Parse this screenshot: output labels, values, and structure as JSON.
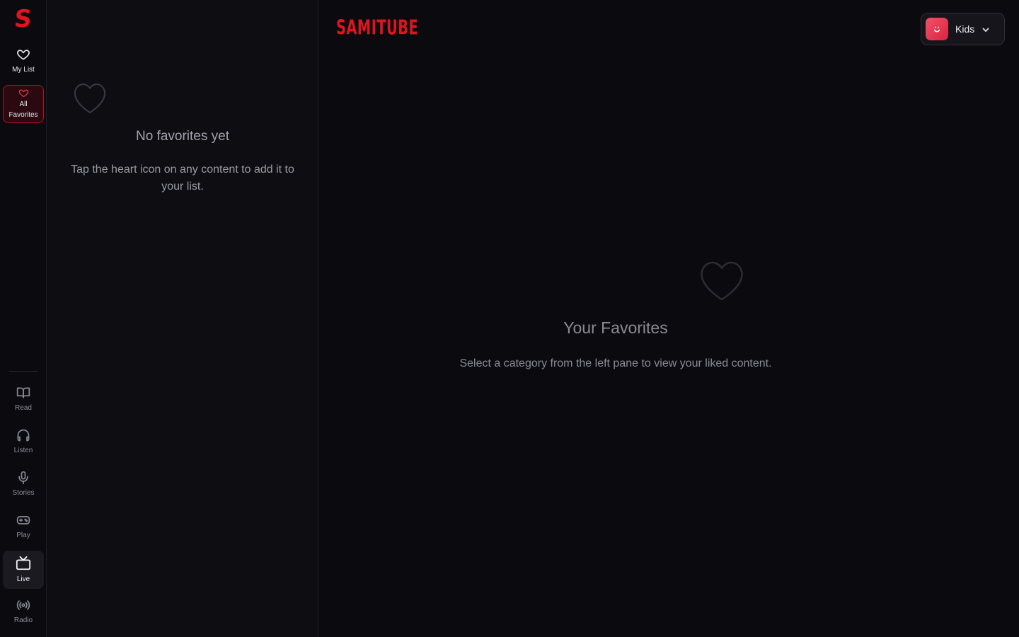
{
  "rail": {
    "logo": "S",
    "top_items": [
      {
        "label": "My List",
        "icon": "heart-icon"
      },
      {
        "label_line1": "All",
        "label_line2": "Favorites",
        "icon": "heart-icon",
        "active": true
      }
    ],
    "bottom_items": [
      {
        "label": "Read",
        "icon": "book-icon"
      },
      {
        "label": "Listen",
        "icon": "headphones-icon"
      },
      {
        "label": "Stories",
        "icon": "microphone-icon"
      },
      {
        "label": "Play",
        "icon": "gamepad-icon"
      },
      {
        "label": "Live",
        "icon": "tv-icon",
        "active": true
      },
      {
        "label": "Radio",
        "icon": "radio-icon"
      }
    ]
  },
  "pane": {
    "empty_title": "No favorites yet",
    "empty_text": "Tap the heart icon on any content to add it to your list."
  },
  "header": {
    "brand": "SAMITUBE",
    "profile_name": "Kids"
  },
  "main": {
    "title": "Your Favorites",
    "text": "Select a category from the left pane to view your liked content."
  },
  "colors": {
    "accent": "#e0141e",
    "background": "#0b0b0f",
    "avatar": "#e83a55"
  }
}
